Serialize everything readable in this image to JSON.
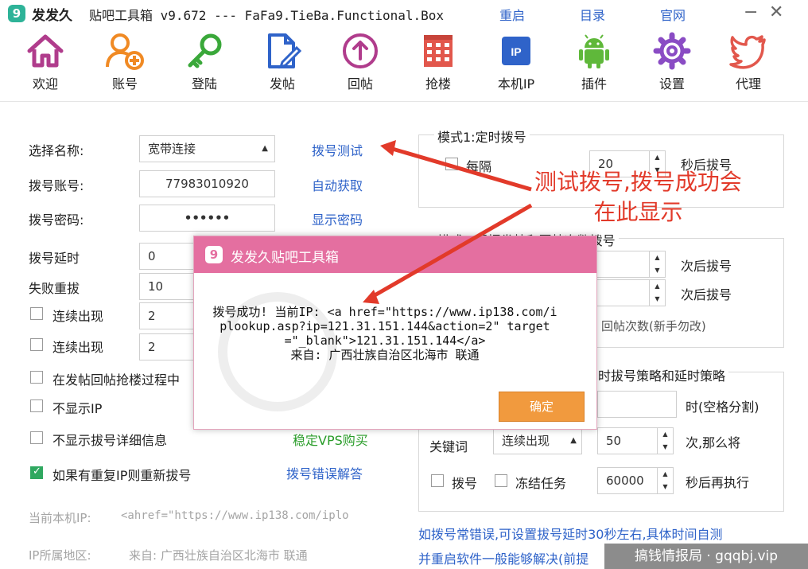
{
  "window": {
    "title": "发发久",
    "subtitle": "贴吧工具箱 v9.672 --- FaFa9.TieBa.Functional.Box",
    "links": {
      "restart": "重启",
      "catalog": "目录",
      "official": "官网"
    },
    "minimize": "−",
    "close": "✕",
    "logo_glyph": "9"
  },
  "toolbar": {
    "items": [
      {
        "label": "欢迎",
        "icon": "home-icon",
        "color": "#b03c8c"
      },
      {
        "label": "账号",
        "icon": "add-user-icon",
        "color": "#f08a24"
      },
      {
        "label": "登陆",
        "icon": "key-icon",
        "color": "#3aa83a"
      },
      {
        "label": "发帖",
        "icon": "edit-document-icon",
        "color": "#2f63c9"
      },
      {
        "label": "回帖",
        "icon": "reply-circle-icon",
        "color": "#b03c8c"
      },
      {
        "label": "抢楼",
        "icon": "building-icon",
        "color": "#e2574c"
      },
      {
        "label": "本机IP",
        "icon": "ip-icon",
        "color": "#2f63c9"
      },
      {
        "label": "插件",
        "icon": "android-icon",
        "color": "#5fb83a"
      },
      {
        "label": "设置",
        "icon": "gear-icon",
        "color": "#8a4cc4"
      },
      {
        "label": "代理",
        "icon": "twitter-bird-icon",
        "color": "#e2574c"
      }
    ]
  },
  "left": {
    "select_name_label": "选择名称:",
    "select_name_value": "宽带连接",
    "dial_test_link": "拨号测试",
    "account_label": "拨号账号:",
    "account_value": "77983010920",
    "auto_get_link": "自动获取",
    "password_label": "拨号密码:",
    "password_value": "••••••",
    "show_password_link": "显示密码",
    "delay_label": "拨号延时",
    "delay_value": "0",
    "retry_label": "失败重拔",
    "retry_value": "10",
    "continuous1_label": "连续出现",
    "continuous1_value": "2",
    "continuous2_label": "连续出现",
    "continuous2_value": "2",
    "during_post_label": "在发帖回帖抢楼过程中",
    "hide_ip_label": "不显示IP",
    "hide_details_label": "不显示拔号详细信息",
    "stable_vps_link": "稳定VPS购买",
    "redial_label": "如果有重复IP则重新拔号",
    "dial_error_link": "拨号错误解答",
    "current_ip_label": "当前本机IP:",
    "current_ip_value": "<ahref=\"https://www.ip138.com/iplo",
    "region_label": "IP所属地区:",
    "region_value": "来自: 广西壮族自治区北海市 联通"
  },
  "right": {
    "mode1_title": "模式1:定时拨号",
    "every_label": "每隔",
    "every_value": "20",
    "seconds_after_dial": "秒后拔号",
    "mode2_title": "模式2:根据发帖和回帖次数拨号",
    "times_after_dial_1": "次后拔号",
    "times_after_dial_2": "次后拔号",
    "reply_count_note": "回帖次数(新手勿改)",
    "strategy_title": "时拔号策略和延时策略",
    "time_split_label": "时(空格分割)",
    "keyword_label": "关键词",
    "keyword_select": "连续出现",
    "keyword_value": "50",
    "then_label": "次,那么将",
    "dial_label": "拨号",
    "freeze_label": "冻结任务",
    "freeze_value": "60000",
    "seconds_rerun": "秒后再执行",
    "note_line1": "如拨号常错误,可设置拔号延时30秒左右,具体时间自测",
    "note_line2": "并重启软件一般能够解决(前提"
  },
  "dialog": {
    "title": "发发久贴吧工具箱",
    "message": "拨号成功! 当前IP: <a href=\"https://www.ip138.com/iplookup.asp?ip=121.31.151.144&action=2\" target=\"_blank\">121.31.151.144</a>\n来自: 广西壮族自治区北海市 联通",
    "ok_label": "确定",
    "header_color": "#e46fa0",
    "ok_color": "#f19a3e"
  },
  "annotation": {
    "line1": "测试拨号,拨号成功会",
    "line2": "在此显示",
    "color": "#e23a2a"
  },
  "watermark": {
    "text": "搞钱情报局 · gqqbj.vip"
  }
}
